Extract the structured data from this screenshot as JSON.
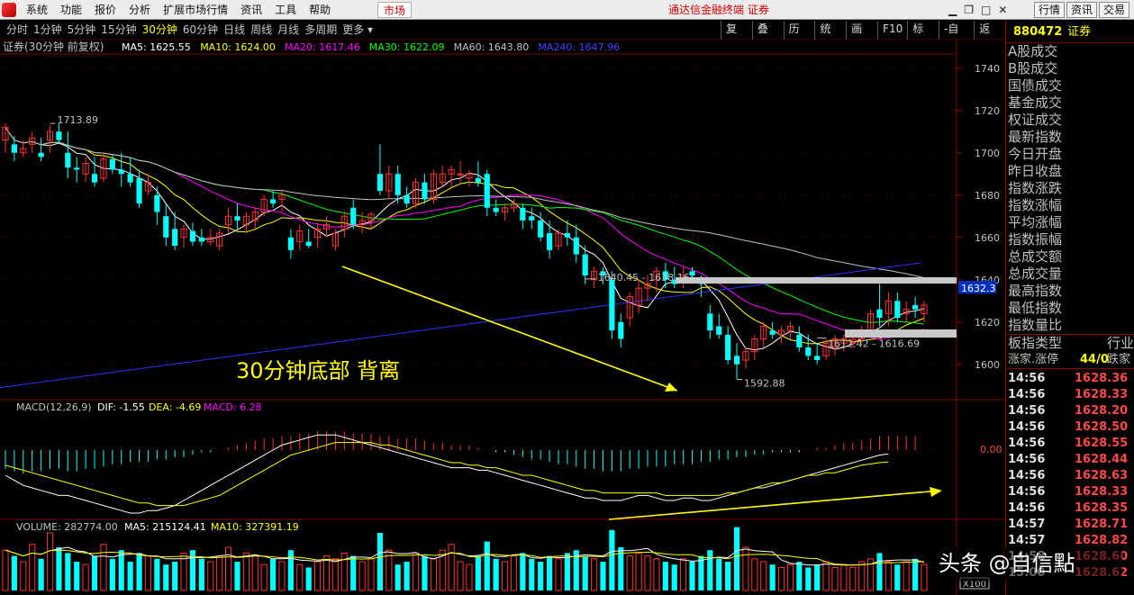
{
  "menubar": {
    "items": [
      "系统",
      "功能",
      "报价",
      "分析",
      "扩展市场行情",
      "资讯",
      "工具",
      "帮助"
    ],
    "market": "市场",
    "title": "通达信金融终端  证券",
    "right_buttons": [
      "行情",
      "资讯",
      "交易"
    ]
  },
  "toolbar": {
    "periods": [
      "分时",
      "1分钟",
      "5分钟",
      "15分钟",
      "30分钟",
      "60分钟",
      "日线",
      "周线",
      "月线",
      "多周期",
      "更多 ▾"
    ],
    "active_period": "30分钟",
    "tools": [
      "复权",
      "叠加",
      "历史",
      "统计",
      "画线",
      "F10",
      "标记",
      "-自选",
      "返回"
    ]
  },
  "main": {
    "security": "证券(30分钟 前复权)",
    "ma": [
      {
        "label": "MA5: 1625.55",
        "color": "#ffffff"
      },
      {
        "label": "MA10: 1624.00",
        "color": "#ffff00"
      },
      {
        "label": "MA20: 1617.46",
        "color": "#ff00ff"
      },
      {
        "label": "MA30: 1622.09",
        "color": "#00ff00"
      },
      {
        "label": "MA60: 1643.80",
        "color": "#c0c0c0"
      },
      {
        "label": "MA240: 1647.96",
        "color": "#4040ff"
      }
    ],
    "annotation": "30分钟底部  背离",
    "price_label": "1632.3",
    "marks": [
      "1713.89",
      "1640.45 - 1638.16",
      "1592.88",
      "1612.42 - 1616.69"
    ]
  },
  "macd": {
    "label": "MACD(12,26,9)",
    "dif": "DIF: -1.55",
    "dea": "DEA: -4.69",
    "macd": "MACD: 6.28",
    "zero": "0.00"
  },
  "volume": {
    "label": "VOLUME: 282774.00",
    "ma5": "MA5: 215124.41",
    "ma10": "MA10: 327391.19",
    "unit": "X100"
  },
  "side": {
    "code": "880472",
    "name": "证券",
    "fields": [
      "A股成交",
      "B股成交",
      "国债成交",
      "基金成交",
      "权证成交",
      "最新指数",
      "今日开盘",
      "昨日收盘",
      "指数涨跌",
      "指数涨幅",
      "平均涨幅",
      "指数振幅",
      "总成交额",
      "总成交量",
      "最高指数",
      "最低指数",
      "指数量比"
    ],
    "board_label": "板指类型",
    "board_value": "行业",
    "limit_label": "涨家.涨停",
    "limit_value": "44/0",
    "limit_label2": "跌家",
    "ticks": [
      {
        "time": "14:56",
        "price": "1628.36"
      },
      {
        "time": "14:56",
        "price": "1628.33"
      },
      {
        "time": "14:56",
        "price": "1628.20"
      },
      {
        "time": "14:56",
        "price": "1628.50"
      },
      {
        "time": "14:56",
        "price": "1628.55"
      },
      {
        "time": "14:56",
        "price": "1628.44"
      },
      {
        "time": "14:56",
        "price": "1628.63"
      },
      {
        "time": "14:56",
        "price": "1628.33"
      },
      {
        "time": "14:56",
        "price": "1628.35"
      },
      {
        "time": "14:57",
        "price": "1628.71"
      },
      {
        "time": "14:57",
        "price": "1628.82"
      },
      {
        "time": "14:58",
        "price": "1628.60"
      },
      {
        "time": "15:00",
        "price": "1628.62"
      }
    ]
  },
  "watermark": "头条 @自信點",
  "chart_data": {
    "type": "candlestick",
    "price_axis": {
      "ticks": [
        1600,
        1620,
        1640,
        1660,
        1680,
        1700,
        1720,
        1740
      ],
      "range": [
        1585,
        1745
      ]
    },
    "candles": [
      [
        1706,
        1714,
        1700,
        1712
      ],
      [
        1704,
        1708,
        1696,
        1700
      ],
      [
        1700,
        1706,
        1698,
        1702
      ],
      [
        1704,
        1710,
        1700,
        1707
      ],
      [
        1700,
        1707,
        1696,
        1698
      ],
      [
        1706,
        1713,
        1700,
        1710
      ],
      [
        1710,
        1714,
        1704,
        1706
      ],
      [
        1700,
        1710,
        1688,
        1693
      ],
      [
        1693,
        1698,
        1686,
        1692
      ],
      [
        1690,
        1698,
        1686,
        1695
      ],
      [
        1690,
        1698,
        1684,
        1686
      ],
      [
        1688,
        1700,
        1686,
        1697
      ],
      [
        1697,
        1699,
        1690,
        1692
      ],
      [
        1692,
        1700,
        1684,
        1690
      ],
      [
        1690,
        1698,
        1684,
        1686
      ],
      [
        1688,
        1692,
        1674,
        1676
      ],
      [
        1682,
        1690,
        1680,
        1686
      ],
      [
        1680,
        1684,
        1666,
        1672
      ],
      [
        1670,
        1676,
        1656,
        1660
      ],
      [
        1664,
        1672,
        1654,
        1656
      ],
      [
        1660,
        1666,
        1655,
        1664
      ],
      [
        1663,
        1667,
        1656,
        1658
      ],
      [
        1660,
        1664,
        1656,
        1658
      ],
      [
        1658,
        1664,
        1656,
        1660
      ],
      [
        1656,
        1664,
        1654,
        1662
      ],
      [
        1666,
        1674,
        1662,
        1670
      ],
      [
        1670,
        1676,
        1664,
        1668
      ],
      [
        1666,
        1672,
        1662,
        1670
      ],
      [
        1668,
        1674,
        1664,
        1672
      ],
      [
        1672,
        1680,
        1670,
        1678
      ],
      [
        1678,
        1682,
        1674,
        1676
      ],
      [
        1678,
        1682,
        1672,
        1680
      ],
      [
        1660,
        1664,
        1650,
        1654
      ],
      [
        1658,
        1666,
        1654,
        1663
      ],
      [
        1658,
        1664,
        1655,
        1656
      ],
      [
        1660,
        1666,
        1655,
        1664
      ],
      [
        1664,
        1670,
        1660,
        1666
      ],
      [
        1656,
        1664,
        1654,
        1662
      ],
      [
        1664,
        1672,
        1660,
        1670
      ],
      [
        1674,
        1678,
        1664,
        1666
      ],
      [
        1666,
        1672,
        1662,
        1668
      ],
      [
        1668,
        1672,
        1664,
        1671
      ],
      [
        1690,
        1704,
        1680,
        1682
      ],
      [
        1682,
        1694,
        1678,
        1690
      ],
      [
        1690,
        1694,
        1676,
        1680
      ],
      [
        1680,
        1684,
        1674,
        1676
      ],
      [
        1676,
        1688,
        1674,
        1686
      ],
      [
        1686,
        1690,
        1676,
        1678
      ],
      [
        1678,
        1692,
        1676,
        1690
      ],
      [
        1686,
        1694,
        1684,
        1690
      ],
      [
        1690,
        1694,
        1684,
        1692
      ],
      [
        1690,
        1696,
        1686,
        1690
      ],
      [
        1688,
        1692,
        1684,
        1690
      ],
      [
        1688,
        1696,
        1684,
        1686
      ],
      [
        1690,
        1692,
        1670,
        1674
      ],
      [
        1674,
        1678,
        1670,
        1672
      ],
      [
        1672,
        1676,
        1668,
        1674
      ],
      [
        1674,
        1678,
        1672,
        1676
      ],
      [
        1674,
        1676,
        1664,
        1668
      ],
      [
        1670,
        1674,
        1664,
        1668
      ],
      [
        1668,
        1672,
        1658,
        1660
      ],
      [
        1662,
        1668,
        1650,
        1654
      ],
      [
        1656,
        1664,
        1654,
        1662
      ],
      [
        1662,
        1668,
        1656,
        1660
      ],
      [
        1660,
        1666,
        1648,
        1652
      ],
      [
        1652,
        1656,
        1638,
        1642
      ],
      [
        1640,
        1646,
        1636,
        1644
      ],
      [
        1644,
        1646,
        1638,
        1642
      ],
      [
        1640,
        1644,
        1612,
        1616
      ],
      [
        1620,
        1624,
        1608,
        1612
      ],
      [
        1622,
        1634,
        1618,
        1632
      ],
      [
        1628,
        1640,
        1624,
        1636
      ],
      [
        1636,
        1642,
        1630,
        1638
      ],
      [
        1640,
        1646,
        1634,
        1644
      ],
      [
        1644,
        1648,
        1636,
        1640
      ],
      [
        1640,
        1646,
        1636,
        1638
      ],
      [
        1640,
        1646,
        1636,
        1642
      ],
      [
        1644,
        1646,
        1640,
        1642
      ],
      [
        1640,
        1642,
        1632,
        1638
      ],
      [
        1624,
        1628,
        1612,
        1616
      ],
      [
        1618,
        1624,
        1612,
        1614
      ],
      [
        1614,
        1618,
        1600,
        1602
      ],
      [
        1604,
        1610,
        1593,
        1600
      ],
      [
        1602,
        1608,
        1598,
        1606
      ],
      [
        1606,
        1614,
        1602,
        1612
      ],
      [
        1612,
        1620,
        1608,
        1618
      ],
      [
        1616,
        1620,
        1612,
        1614
      ],
      [
        1614,
        1618,
        1610,
        1616
      ],
      [
        1616,
        1620,
        1612,
        1618
      ],
      [
        1614,
        1618,
        1606,
        1608
      ],
      [
        1608,
        1614,
        1602,
        1604
      ],
      [
        1604,
        1610,
        1600,
        1602
      ],
      [
        1604,
        1612,
        1602,
        1610
      ],
      [
        1608,
        1614,
        1604,
        1612
      ],
      [
        1610,
        1614,
        1606,
        1612
      ],
      [
        1610,
        1614,
        1608,
        1612
      ],
      [
        1612,
        1618,
        1610,
        1616
      ],
      [
        1616,
        1626,
        1614,
        1624
      ],
      [
        1626,
        1638,
        1618,
        1622
      ],
      [
        1624,
        1634,
        1618,
        1630
      ],
      [
        1630,
        1634,
        1620,
        1622
      ],
      [
        1624,
        1630,
        1620,
        1626
      ],
      [
        1628,
        1632,
        1622,
        1626
      ],
      [
        1624,
        1630,
        1620,
        1628
      ]
    ],
    "volume": [
      14,
      12,
      10,
      16,
      11,
      20,
      15,
      13,
      10,
      9,
      12,
      16,
      11,
      14,
      10,
      13,
      12,
      11,
      9,
      10,
      13,
      14,
      11,
      10,
      12,
      15,
      10,
      13,
      12,
      9,
      11,
      10,
      14,
      9,
      8,
      10,
      12,
      11,
      13,
      12,
      10,
      11,
      20,
      14,
      9,
      10,
      13,
      12,
      11,
      14,
      16,
      10,
      9,
      12,
      17,
      11,
      10,
      12,
      13,
      11,
      10,
      12,
      11,
      13,
      14,
      12,
      11,
      10,
      21,
      15,
      12,
      13,
      12,
      11,
      10,
      9,
      11,
      10,
      12,
      14,
      11,
      10,
      22,
      15,
      11,
      10,
      9,
      8,
      9,
      10,
      8,
      9,
      10,
      8,
      9,
      8,
      10,
      11,
      13,
      10,
      9,
      10,
      11,
      9
    ],
    "macd_hist": [
      -8,
      -9,
      -10,
      -9,
      -9,
      -8,
      -8,
      -9,
      -9,
      -8,
      -8,
      -7,
      -6,
      -6,
      -5,
      -5,
      -5,
      -4,
      -4,
      -3,
      -3,
      -2,
      -1,
      -1,
      0,
      1,
      2,
      3,
      4,
      5,
      5,
      6,
      6,
      7,
      7,
      8,
      8,
      8,
      8,
      7,
      7,
      7,
      6,
      6,
      5,
      5,
      5,
      4,
      3,
      3,
      2,
      2,
      2,
      1,
      0,
      -1,
      -1,
      -2,
      -3,
      -4,
      -4,
      -5,
      -6,
      -6,
      -7,
      -8,
      -8,
      -9,
      -9,
      -9,
      -8,
      -8,
      -7,
      -7,
      -7,
      -6,
      -6,
      -6,
      -5,
      -5,
      -4,
      -4,
      -3,
      -3,
      -2,
      -2,
      -1,
      -1,
      -1,
      -1,
      0,
      1,
      1,
      2,
      3,
      3,
      4,
      5,
      6,
      6,
      6,
      6,
      6
    ],
    "dif": [
      -10,
      -12,
      -14,
      -15,
      -16,
      -17,
      -18,
      -18,
      -19,
      -20,
      -21,
      -22,
      -23,
      -24,
      -25,
      -25,
      -24,
      -24,
      -23,
      -22,
      -20,
      -18,
      -16,
      -14,
      -12,
      -10,
      -8,
      -6,
      -4,
      -2,
      0,
      2,
      3,
      4,
      5,
      6,
      6,
      6,
      5,
      4,
      3,
      2,
      1,
      0,
      -1,
      -2,
      -3,
      -4,
      -5,
      -6,
      -7,
      -7,
      -7,
      -8,
      -8,
      -9,
      -10,
      -11,
      -12,
      -13,
      -14,
      -15,
      -16,
      -17,
      -18,
      -19,
      -19,
      -20,
      -20,
      -20,
      -19,
      -18,
      -18,
      -19,
      -20,
      -20,
      -19,
      -19,
      -20,
      -20,
      -19,
      -18,
      -17,
      -16,
      -15,
      -15,
      -14,
      -13,
      -12,
      -11,
      -10,
      -9,
      -8,
      -7,
      -6,
      -5,
      -4,
      -3,
      -2,
      -1.55
    ],
    "dea": [
      -6,
      -7,
      -8,
      -9,
      -10,
      -11,
      -12,
      -13,
      -14,
      -15,
      -16,
      -17,
      -18,
      -19,
      -20,
      -21,
      -21,
      -22,
      -22,
      -22,
      -22,
      -21,
      -20,
      -19,
      -18,
      -16,
      -14,
      -12,
      -10,
      -8,
      -6,
      -4,
      -2,
      -1,
      0,
      1,
      2,
      3,
      3,
      3,
      3,
      3,
      2,
      2,
      1,
      0,
      -1,
      -2,
      -3,
      -4,
      -5,
      -5,
      -6,
      -6,
      -7,
      -7,
      -8,
      -9,
      -10,
      -10,
      -11,
      -12,
      -13,
      -14,
      -15,
      -16,
      -16,
      -17,
      -17,
      -17,
      -17,
      -17,
      -17,
      -17,
      -18,
      -18,
      -18,
      -18,
      -18,
      -18,
      -18,
      -17,
      -17,
      -16,
      -15,
      -14,
      -13,
      -13,
      -12,
      -11,
      -10,
      -10,
      -9,
      -9,
      -8,
      -7,
      -6,
      -5.5,
      -5,
      -4.69
    ]
  }
}
